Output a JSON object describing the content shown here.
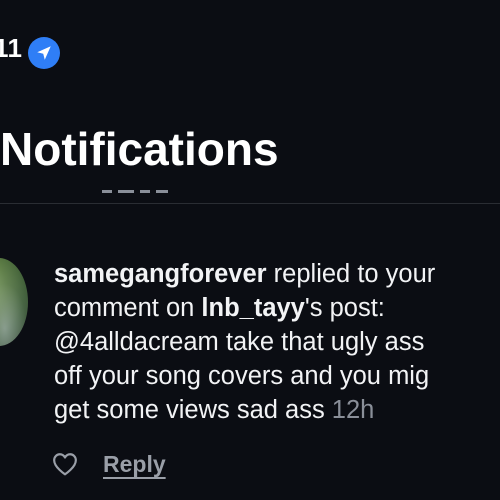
{
  "status_bar": {
    "time": "11",
    "location_icon": "location-arrow-icon"
  },
  "header": {
    "title": "Notifications"
  },
  "notification": {
    "username": "samegangforever",
    "action_text": " replied to your",
    "line2_prefix": "comment on ",
    "post_owner": "lnb_tayy",
    "line2_suffix": "'s post:",
    "line3": "@4alldacream take that ugly ass",
    "line4": "off your song covers and you mig",
    "line5": "get some views sad ass ",
    "timestamp": "12h",
    "reply_label": "Reply",
    "like_icon": "heart-icon"
  },
  "colors": {
    "background": "#0b0d13",
    "text": "#f2f3f5",
    "muted": "#8a8f99",
    "accent": "#2f7ef6",
    "divider": "#2a2d33"
  }
}
